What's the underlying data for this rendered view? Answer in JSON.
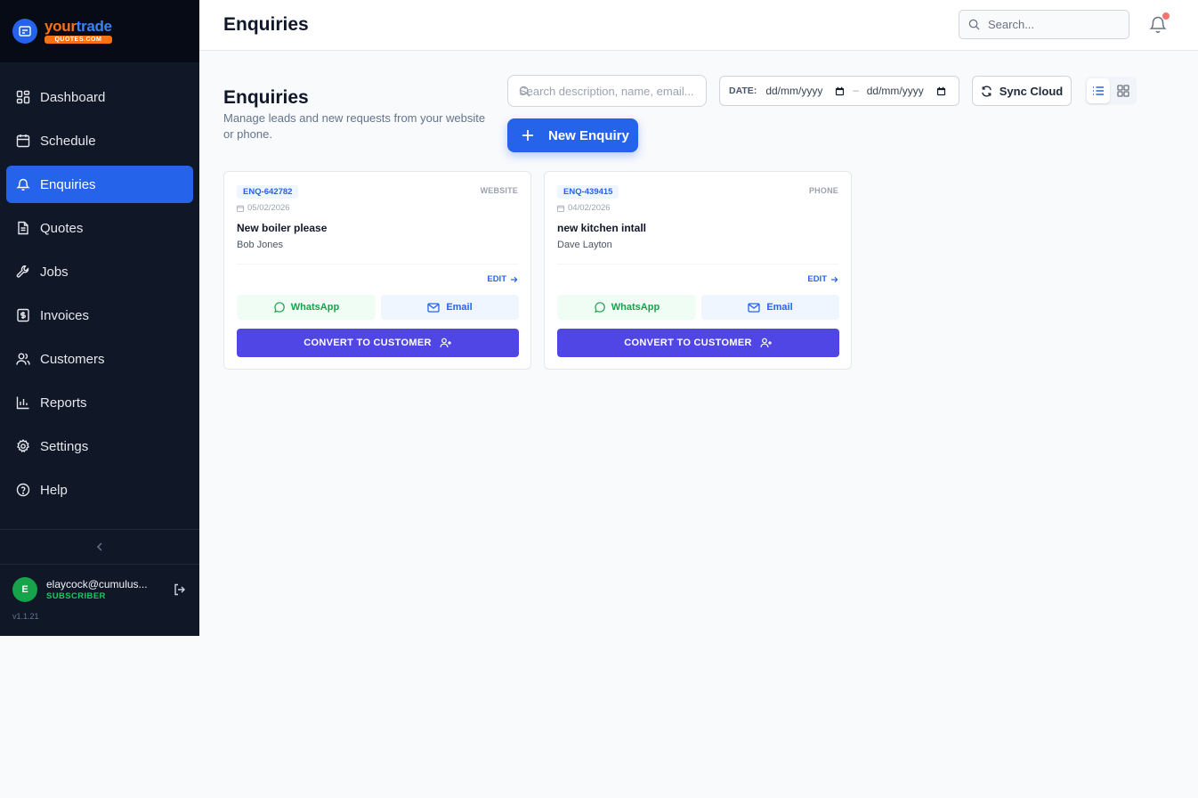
{
  "brand": {
    "word_part1": "your",
    "word_part2": "trade",
    "tagline": "QUOTES.COM"
  },
  "sidebar": {
    "items": [
      {
        "label": "Dashboard",
        "icon": "dashboard-icon"
      },
      {
        "label": "Schedule",
        "icon": "calendar-icon"
      },
      {
        "label": "Enquiries",
        "icon": "bell-icon",
        "active": true
      },
      {
        "label": "Quotes",
        "icon": "document-icon"
      },
      {
        "label": "Jobs",
        "icon": "wrench-icon"
      },
      {
        "label": "Invoices",
        "icon": "invoice-icon"
      },
      {
        "label": "Customers",
        "icon": "users-icon"
      },
      {
        "label": "Reports",
        "icon": "bar-chart-icon"
      },
      {
        "label": "Settings",
        "icon": "gear-icon"
      },
      {
        "label": "Help",
        "icon": "help-icon"
      }
    ],
    "user": {
      "initial": "E",
      "email": "elaycock@cumulus...",
      "role": "SUBSCRIBER"
    },
    "version": "v1.1.21"
  },
  "header": {
    "title": "Enquiries",
    "search_placeholder": "Search..."
  },
  "page": {
    "title": "Enquiries",
    "subtitle": "Manage leads and new requests from your website or phone.",
    "search_placeholder": "Search description, name, email...",
    "date_label": "DATE:",
    "date_from": "dd/mm/yyyy",
    "date_separator": "–",
    "date_to": "dd/mm/yyyy",
    "sync_label": "Sync Cloud",
    "new_label": "New Enquiry"
  },
  "colors": {
    "primary": "#2563eb",
    "convert": "#4f46e5",
    "sidebar": "#101828",
    "whatsapp": "#16a34a"
  },
  "enquiries": [
    {
      "id": "ENQ-642782",
      "source": "WEBSITE",
      "date": "05/02/2026",
      "title": "New boiler please",
      "name": "Bob Jones",
      "edit_label": "EDIT",
      "whatsapp_label": "WhatsApp",
      "email_label": "Email",
      "convert_label": "CONVERT TO CUSTOMER"
    },
    {
      "id": "ENQ-439415",
      "source": "PHONE",
      "date": "04/02/2026",
      "title": "new kitchen intall",
      "name": "Dave Layton",
      "edit_label": "EDIT",
      "whatsapp_label": "WhatsApp",
      "email_label": "Email",
      "convert_label": "CONVERT TO CUSTOMER"
    }
  ]
}
